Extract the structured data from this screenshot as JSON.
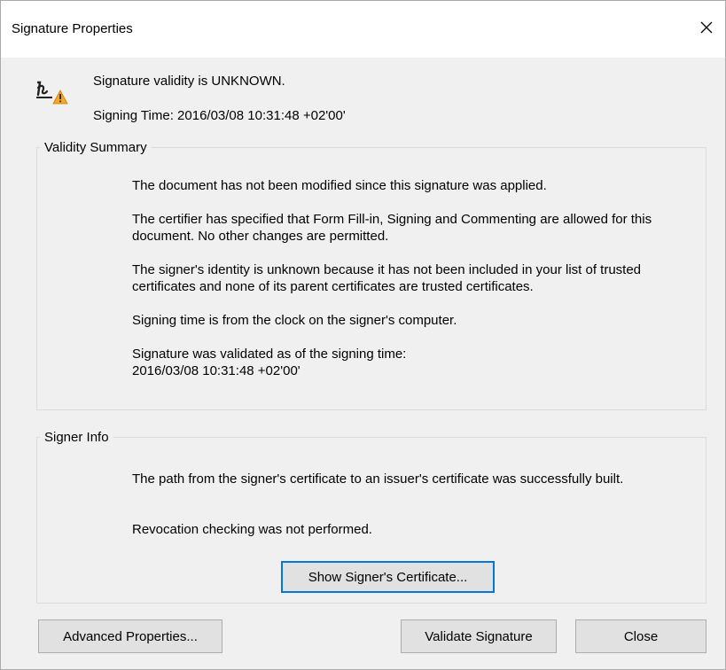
{
  "dialog": {
    "title": "Signature Properties"
  },
  "header": {
    "validity_text": "Signature validity is UNKNOWN.",
    "signing_time_text": "Signing Time:  2016/03/08 10:31:48 +02'00'"
  },
  "validity_summary": {
    "legend": "Validity Summary",
    "paragraphs": [
      "The document has not been modified since this signature was applied.",
      "The certifier has specified that Form Fill-in, Signing and Commenting are allowed for this document. No other changes are permitted.",
      "The signer's identity is unknown because it has not been included in your list of trusted certificates and none of its parent certificates are trusted certificates.",
      "Signing time is from the clock on the signer's computer.",
      "Signature was validated as of the signing time:",
      "2016/03/08 10:31:48 +02'00'"
    ]
  },
  "signer_info": {
    "legend": "Signer Info",
    "paragraphs": [
      "The path from the signer's certificate to an issuer's certificate was successfully built.",
      "Revocation checking was not performed."
    ],
    "show_certificate_label": "Show Signer's Certificate..."
  },
  "buttons": {
    "advanced_properties": "Advanced Properties...",
    "validate_signature": "Validate Signature",
    "close": "Close"
  },
  "icons": {
    "signature_warning": "signature-warning-icon",
    "close": "close-icon"
  },
  "colors": {
    "warning": "#f5a623",
    "focus_border": "#0078d7",
    "button_bg": "#e1e1e1",
    "dialog_bg": "#f0f0f0"
  }
}
